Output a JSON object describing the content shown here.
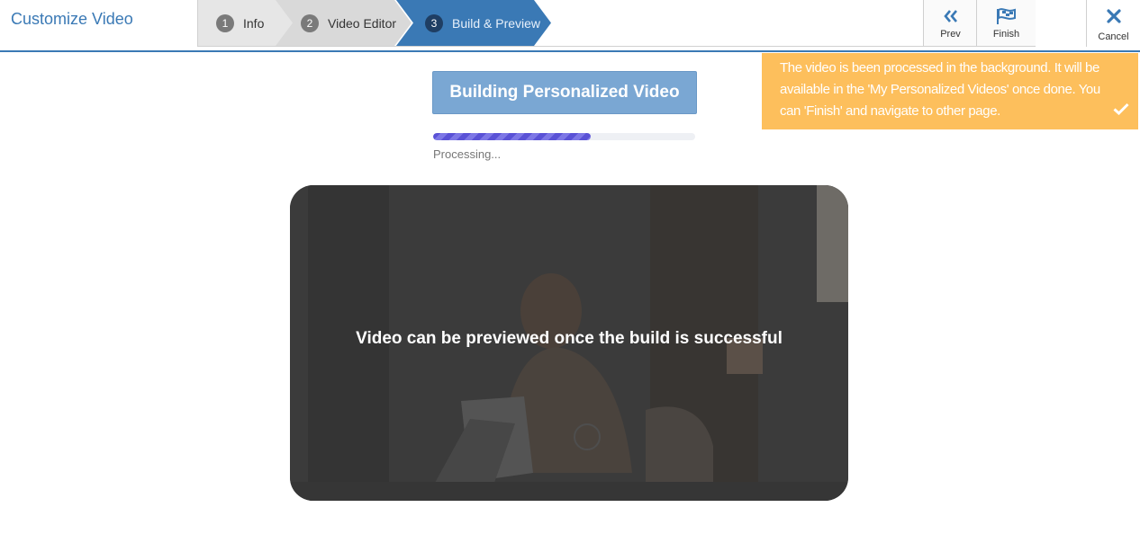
{
  "header": {
    "title": "Customize Video"
  },
  "wizard": {
    "steps": [
      {
        "num": "1",
        "label": "Info"
      },
      {
        "num": "2",
        "label": "Video Editor"
      },
      {
        "num": "3",
        "label": "Build & Preview"
      }
    ],
    "prev_label": "Prev",
    "finish_label": "Finish",
    "cancel_label": "Cancel"
  },
  "build": {
    "button_label": "Building Personalized Video",
    "progress_percent": 60,
    "status_text": "Processing..."
  },
  "preview": {
    "message": "Video can be previewed once the build is successful"
  },
  "toast": {
    "message": "The video is been processed in the background. It will be available in the 'My Personalized Videos' once done. You can 'Finish' and navigate to other page."
  },
  "icons": {
    "prev": "double-chevron-left-icon",
    "finish": "flag-icon",
    "cancel": "close-icon",
    "toast": "checkmark-icon"
  },
  "colors": {
    "brand": "#3a79b5",
    "build_button": "#7aa7d3",
    "progress": "#5a52d6",
    "toast": "#fdbf5c"
  }
}
